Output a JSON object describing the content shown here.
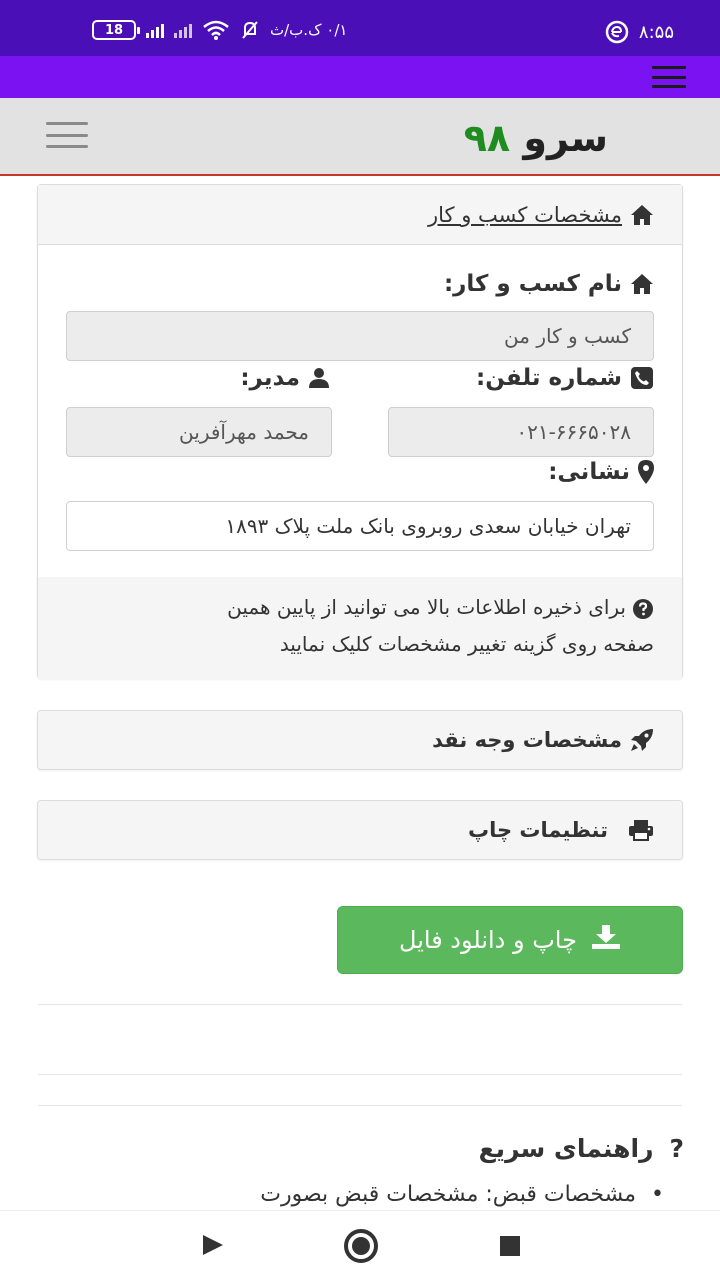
{
  "status_bar": {
    "time": "۸:۵۵",
    "speed": "۰/۱ ک.ب/ث",
    "battery": "18"
  },
  "site": {
    "logo_text": "سرو",
    "logo_number": "۹۸"
  },
  "business_panel": {
    "header": "مشخصات کسب و کار",
    "name_label": "نام کسب و کار:",
    "name_value": "کسب و کار من",
    "phone_label": "شماره تلفن:",
    "phone_value": "۰۲۱-۶۶۶۵۰۲۸",
    "manager_label": "مدیر:",
    "manager_value": "محمد مهرآفرین",
    "address_label": "نشانی:",
    "address_value": "تهران خیابان سعدی روبروی بانک ملت پلاک ۱۸۹۳",
    "note_line1": "برای ذخیره اطلاعات بالا می توانید از پایین همین",
    "note_line2": "صفحه روی گزینه تغییر مشخصات کلیک نمایید"
  },
  "cash_panel": {
    "header": "مشخصات وجه نقد"
  },
  "print_panel": {
    "header": "تنظیمات چاپ"
  },
  "download_button": {
    "label": "چاپ و دانلود فایل"
  },
  "guide": {
    "title": "راهنمای سریع",
    "item1": "مشخصات قبض: مشخصات قبض بصورت"
  },
  "colors": {
    "status_bar": "#4b0fb8",
    "app_bar": "#7b12f2",
    "logo_number": "#1e8c1e",
    "button": "#5cb85c",
    "header_border": "#c0392b"
  },
  "icons": {
    "status": [
      "app-icon",
      "mute-icon",
      "wifi-icon",
      "signal-icon",
      "battery-icon"
    ],
    "panels": [
      "home-icon",
      "user-icon",
      "phone-icon",
      "map-marker-icon",
      "question-circle-icon",
      "rocket-icon",
      "printer-icon",
      "download-icon"
    ],
    "nav": [
      "back-icon",
      "home-nav-icon",
      "recents-icon"
    ]
  }
}
